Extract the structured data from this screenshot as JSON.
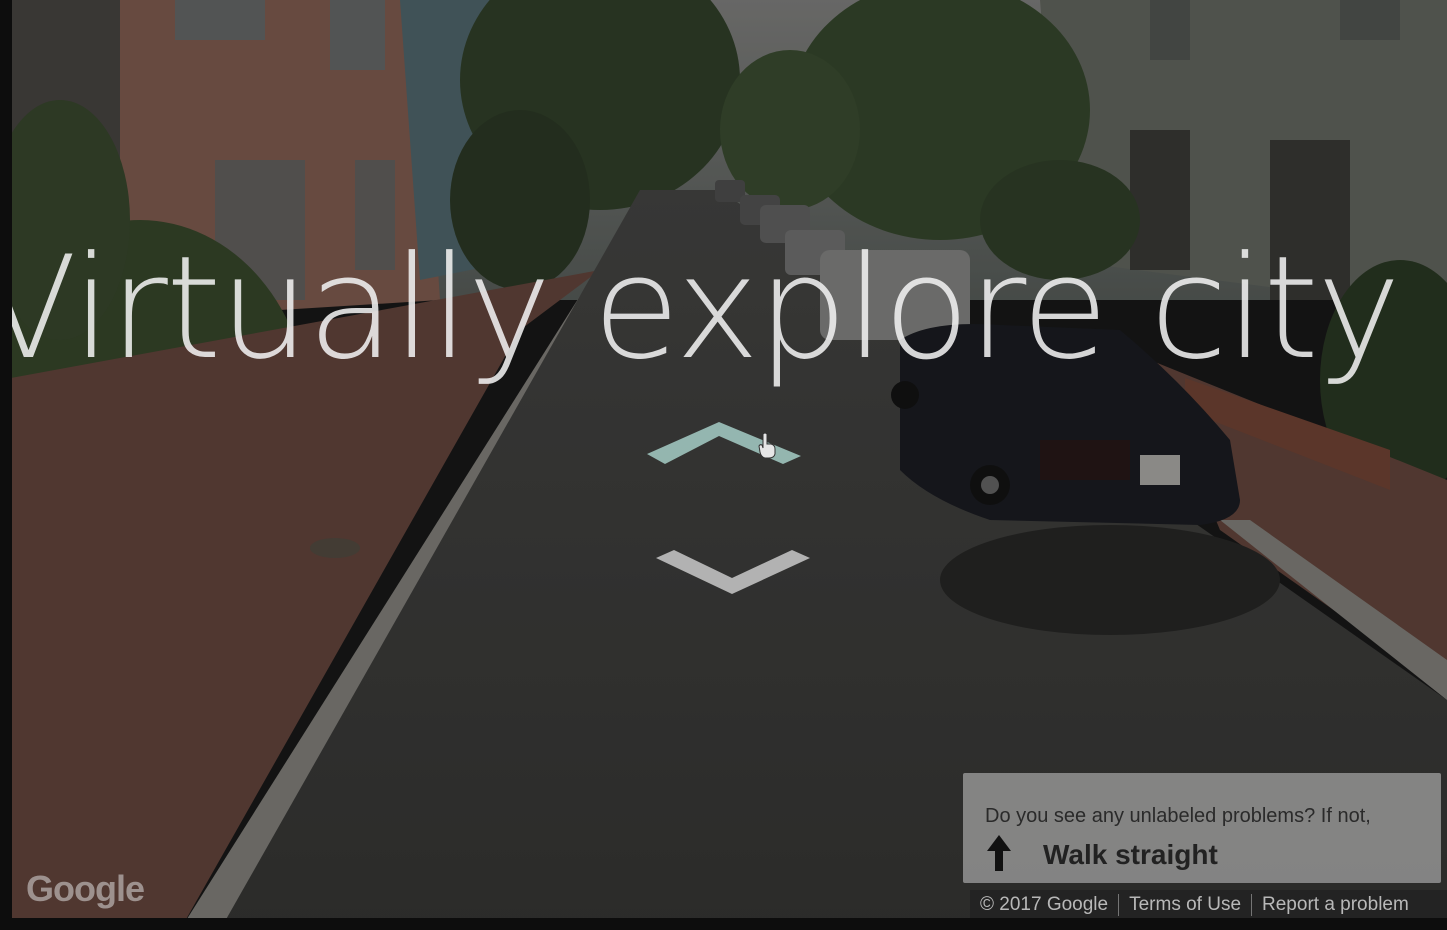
{
  "headline": "Virtually explore city s",
  "navigation": {
    "forward_arrow_icon": "chevron-up-icon",
    "backward_arrow_icon": "chevron-down-icon"
  },
  "map_attribution": {
    "logo_text": "Google"
  },
  "prompt": {
    "question": "Do you see any unlabeled problems? If not,",
    "action_icon": "arrow-up-icon",
    "action_label": "Walk straight"
  },
  "footer": {
    "copyright": "© 2017 Google",
    "terms": "Terms of Use",
    "report": "Report a problem"
  },
  "colors": {
    "arrow_active": "#9fc4be",
    "arrow_inactive": "#c9c9c9",
    "overlay": "#000000"
  }
}
